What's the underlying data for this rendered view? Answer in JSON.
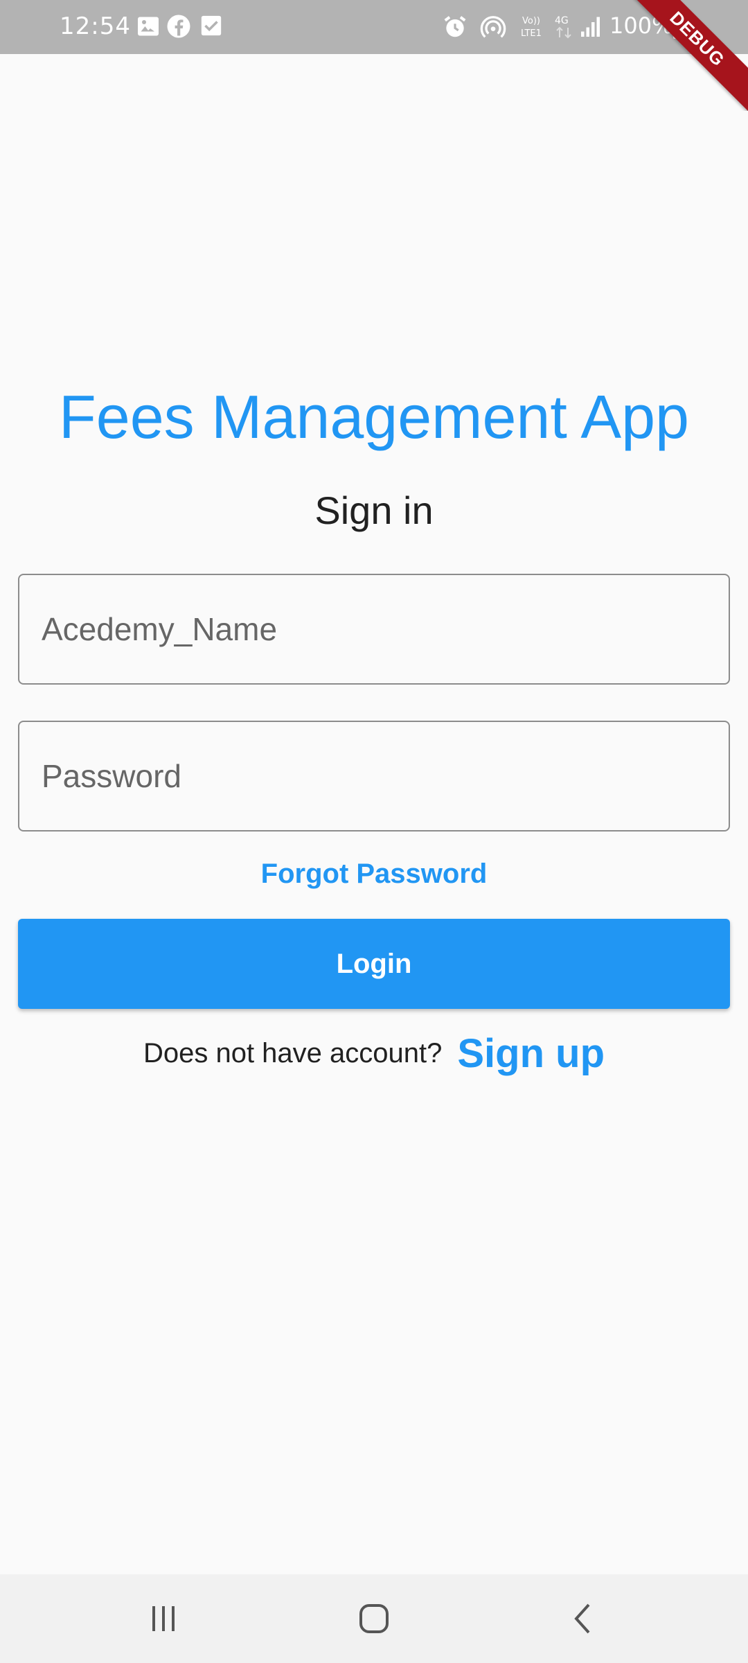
{
  "status_bar": {
    "time": "12:54",
    "battery": "100%",
    "icons": [
      "gallery-icon",
      "facebook-icon",
      "checkbox-icon",
      "alarm-icon",
      "hotspot-icon",
      "volte-icon",
      "4g-icon",
      "signal-icon",
      "battery-charging-icon"
    ]
  },
  "debug_banner": "DEBUG",
  "app_title": "Fees Management App",
  "sign_in_heading": "Sign in",
  "academy_field": {
    "placeholder": "Acedemy_Name",
    "value": ""
  },
  "password_field": {
    "placeholder": "Password",
    "value": ""
  },
  "forgot_password": "Forgot Password",
  "login_button": "Login",
  "signup": {
    "prompt": "Does not have account?",
    "link": "Sign up"
  },
  "nav_bar": [
    "recents-icon",
    "home-icon",
    "back-icon"
  ],
  "colors": {
    "accent": "#2196f3",
    "status_bar": "#b3b3b3",
    "background": "#fafafa",
    "debug": "#a6141c"
  }
}
